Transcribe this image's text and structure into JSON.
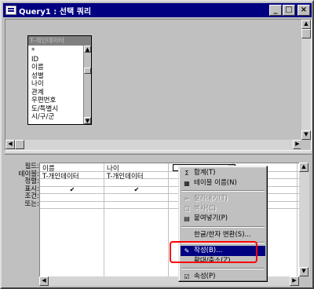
{
  "window": {
    "title": "Query1 : 선택 쿼리",
    "min": "_",
    "max": "□",
    "close": "×"
  },
  "table_box": {
    "title": "T-개인데이터",
    "fields": [
      "*",
      "ID",
      "이름",
      "성별",
      "나이",
      "관계",
      "우편번호",
      "도/특별시",
      "시/구/군"
    ]
  },
  "row_labels": [
    "필드:",
    "테이블:",
    "정렬:",
    "표시:",
    "조건:",
    "또는:"
  ],
  "columns": [
    {
      "field": "이름",
      "table": "T-개인데이터",
      "show": "✔"
    },
    {
      "field": "나이",
      "table": "T-개인데이터",
      "show": "✔"
    }
  ],
  "context_menu": {
    "items": [
      {
        "icon": "sigma-icon",
        "glyph": "Σ",
        "label": "합계(T)",
        "state": "normal"
      },
      {
        "icon": "table-names-icon",
        "glyph": "▦",
        "label": "테이블 이름(N)",
        "state": "normal"
      },
      {
        "sep": true
      },
      {
        "icon": "cut-icon",
        "glyph": "✂",
        "label": "잘라내기(T)",
        "state": "disabled"
      },
      {
        "icon": "copy-icon",
        "glyph": "❐",
        "label": "복사(C)",
        "state": "disabled"
      },
      {
        "icon": "paste-icon",
        "glyph": "▤",
        "label": "붙여넣기(P)",
        "state": "normal"
      },
      {
        "sep": true
      },
      {
        "icon": "",
        "glyph": "",
        "label": "한글/한자 변환(S)...",
        "state": "normal"
      },
      {
        "sep": true
      },
      {
        "icon": "build-icon",
        "glyph": "✎",
        "label": "작성(B)...",
        "state": "active"
      },
      {
        "icon": "",
        "glyph": "",
        "label": "확대/축소(Z)...",
        "state": "normal"
      },
      {
        "sep": true
      },
      {
        "icon": "properties-icon",
        "glyph": "☑",
        "label": "속성(P)",
        "state": "normal"
      }
    ]
  }
}
